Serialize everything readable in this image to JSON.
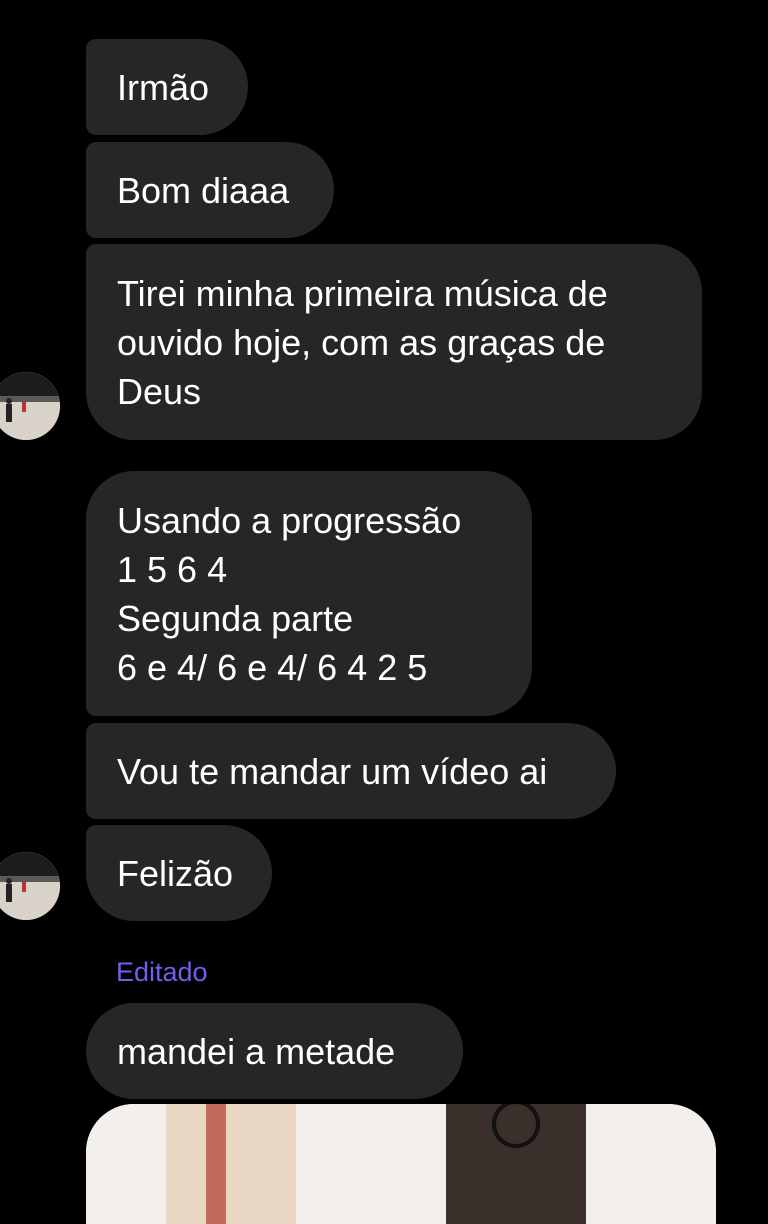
{
  "messages": [
    {
      "text": "Irmão"
    },
    {
      "text": "Bom diaaa"
    },
    {
      "text": "Tirei minha primeira música de\nouvido hoje, com as graças de\nDeus"
    },
    {
      "text": "Usando a progressão\n1 5 6 4\nSegunda parte\n6 e 4/ 6 e 4/ 6 4 2 5"
    },
    {
      "text": "Vou te mandar um vídeo ai"
    },
    {
      "text": "Felizão"
    },
    {
      "text": "mandei a metade"
    }
  ],
  "edited_label": "Editado",
  "colors": {
    "background": "#000000",
    "bubble": "#262626",
    "text": "#ffffff",
    "edited_label": "#6d5ff0"
  }
}
